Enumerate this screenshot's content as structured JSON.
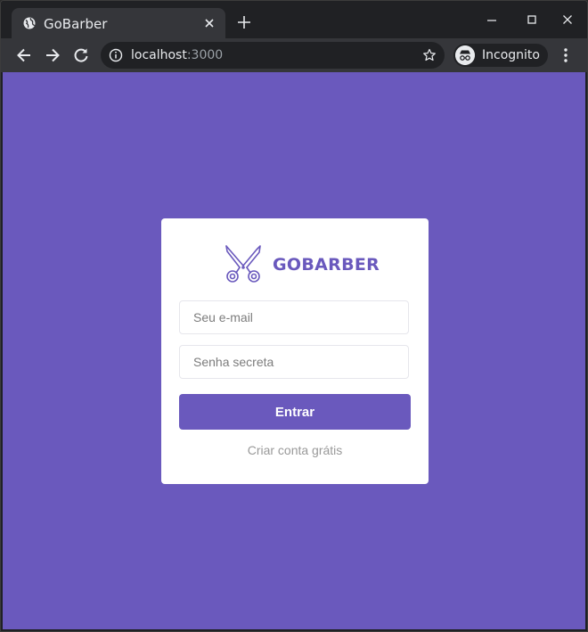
{
  "browser": {
    "tab_title": "GoBarber",
    "url_host": "localhost",
    "url_port": ":3000",
    "profile_label": "Incognito"
  },
  "login": {
    "brand": "GOBARBER",
    "email_placeholder": "Seu e-mail",
    "password_placeholder": "Senha secreta",
    "submit_label": "Entrar",
    "signup_link": "Criar conta grátis"
  },
  "colors": {
    "brand_purple": "#6a59bd",
    "card_bg": "#ffffff"
  },
  "icons": {
    "logo": "scissors-icon",
    "favicon": "globe-icon"
  }
}
